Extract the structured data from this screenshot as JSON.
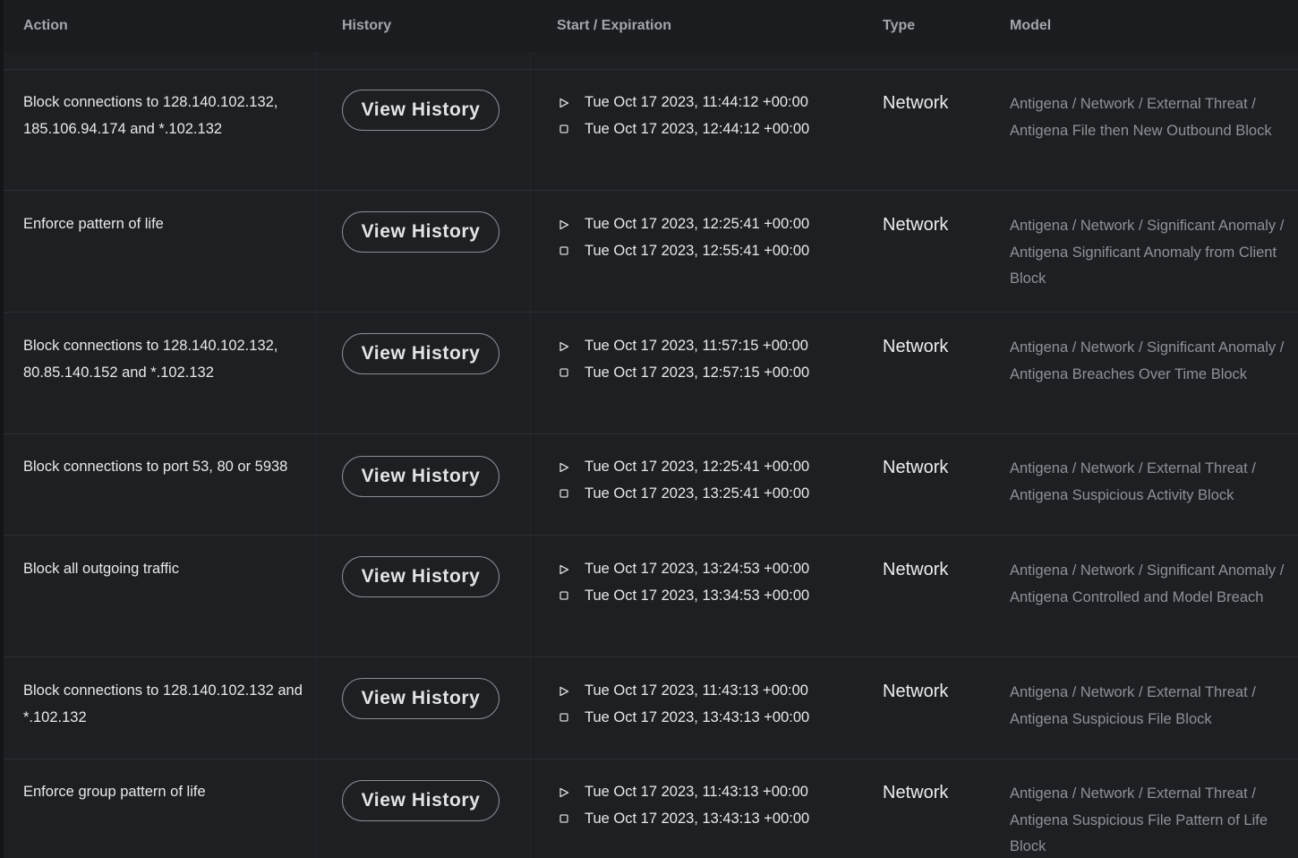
{
  "headers": {
    "action": "Action",
    "history": "History",
    "start_expiration": "Start / Expiration",
    "type": "Type",
    "model": "Model"
  },
  "rows": [
    {
      "action": "Block connections to 128.140.102.132, 185.106.94.174 and *.102.132",
      "history_button": "View History",
      "start": "Tue Oct 17 2023, 11:44:12 +00:00",
      "expiration": "Tue Oct 17 2023, 12:44:12 +00:00",
      "type": "Network",
      "model": "Antigena / Network / External Threat / Antigena File then New Outbound Block"
    },
    {
      "action": "Enforce pattern of life",
      "history_button": "View History",
      "start": "Tue Oct 17 2023, 12:25:41 +00:00",
      "expiration": "Tue Oct 17 2023, 12:55:41 +00:00",
      "type": "Network",
      "model": "Antigena / Network / Significant Anomaly / Antigena Significant Anomaly from Client Block"
    },
    {
      "action": "Block connections to 128.140.102.132, 80.85.140.152 and *.102.132",
      "history_button": "View History",
      "start": "Tue Oct 17 2023, 11:57:15 +00:00",
      "expiration": "Tue Oct 17 2023, 12:57:15 +00:00",
      "type": "Network",
      "model": "Antigena / Network / Significant Anomaly / Antigena Breaches Over Time Block"
    },
    {
      "action": "Block connections to port 53, 80 or 5938",
      "history_button": "View History",
      "start": "Tue Oct 17 2023, 12:25:41 +00:00",
      "expiration": "Tue Oct 17 2023, 13:25:41 +00:00",
      "type": "Network",
      "model": "Antigena / Network / External Threat / Antigena Suspicious Activity Block"
    },
    {
      "action": "Block all outgoing traffic",
      "history_button": "View History",
      "start": "Tue Oct 17 2023, 13:24:53 +00:00",
      "expiration": "Tue Oct 17 2023, 13:34:53 +00:00",
      "type": "Network",
      "model": "Antigena / Network / Significant Anomaly / Antigena Controlled and Model Breach"
    },
    {
      "action": "Block connections to 128.140.102.132 and *.102.132",
      "history_button": "View History",
      "start": "Tue Oct 17 2023, 11:43:13 +00:00",
      "expiration": "Tue Oct 17 2023, 13:43:13 +00:00",
      "type": "Network",
      "model": "Antigena / Network / External Threat / Antigena Suspicious File Block"
    },
    {
      "action": "Enforce group pattern of life",
      "history_button": "View History",
      "start": "Tue Oct 17 2023, 11:43:13 +00:00",
      "expiration": "Tue Oct 17 2023, 13:43:13 +00:00",
      "type": "Network",
      "model": "Antigena / Network / External Threat / Antigena Suspicious File Pattern of Life Block"
    }
  ],
  "icons": {
    "start": "play-outline-icon",
    "expiration": "stop-outline-icon"
  },
  "colors": {
    "background": "#1e1f23",
    "header_background": "#1b1c20",
    "row_divider": "#2d2e33",
    "primary_text": "#e8e9eb",
    "muted_text": "#8f9196",
    "button_border": "#8b8d92"
  }
}
